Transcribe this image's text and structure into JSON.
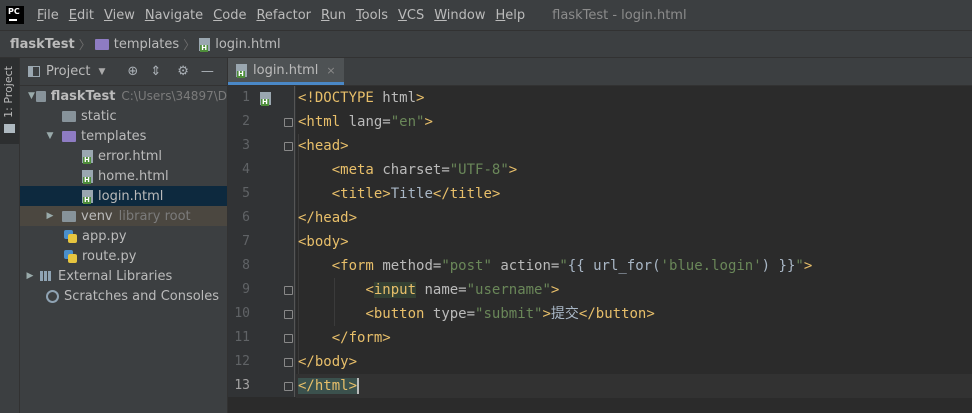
{
  "menubar": {
    "logo": "PC",
    "items": [
      {
        "label": "File",
        "u": "F",
        "rest": "ile"
      },
      {
        "label": "Edit",
        "u": "E",
        "rest": "dit"
      },
      {
        "label": "View",
        "u": "V",
        "rest": "iew"
      },
      {
        "label": "Navigate",
        "u": "N",
        "rest": "avigate"
      },
      {
        "label": "Code",
        "u": "C",
        "rest": "ode"
      },
      {
        "label": "Refactor",
        "u": "R",
        "rest": "efactor"
      },
      {
        "label": "Run",
        "u": "R",
        "rest": "un"
      },
      {
        "label": "Tools",
        "u": "T",
        "rest": "ools"
      },
      {
        "label": "VCS",
        "u": "V",
        "rest": "CS"
      },
      {
        "label": "Window",
        "u": "W",
        "rest": "indow"
      },
      {
        "label": "Help",
        "u": "H",
        "rest": "elp"
      }
    ],
    "window_title": "flaskTest - login.html"
  },
  "breadcrumb": [
    "flaskTest",
    "templates",
    "login.html"
  ],
  "left_stripe": {
    "label": "1: Project"
  },
  "project": {
    "title": "Project",
    "tree": [
      {
        "label": "flaskTest",
        "extra": "C:\\Users\\34897\\D",
        "icon": "folder-grey",
        "depth": 0,
        "arrow": "▼"
      },
      {
        "label": "static",
        "icon": "folder-grey",
        "depth": 1,
        "arrow": ""
      },
      {
        "label": "templates",
        "icon": "folder-purple",
        "depth": 1,
        "arrow": "▼"
      },
      {
        "label": "error.html",
        "icon": "html",
        "depth": 2,
        "arrow": ""
      },
      {
        "label": "home.html",
        "icon": "html",
        "depth": 2,
        "arrow": ""
      },
      {
        "label": "login.html",
        "icon": "html",
        "depth": 2,
        "arrow": "",
        "selected": true
      },
      {
        "label": "venv",
        "extra": "library root",
        "icon": "folder-grey",
        "depth": 1,
        "arrow": "▶",
        "excluded": true
      },
      {
        "label": "app.py",
        "icon": "py",
        "depth": 1,
        "arrow": ""
      },
      {
        "label": "route.py",
        "icon": "py",
        "depth": 1,
        "arrow": ""
      },
      {
        "label": "External Libraries",
        "icon": "lib",
        "depth": 0,
        "arrow": "▶"
      },
      {
        "label": "Scratches and Consoles",
        "icon": "scratch",
        "depth": 0,
        "arrow": ""
      }
    ]
  },
  "editor": {
    "tab": "login.html",
    "tab_close": "×",
    "line_numbers": [
      "1",
      "2",
      "3",
      "4",
      "5",
      "6",
      "7",
      "8",
      "9",
      "10",
      "11",
      "12",
      "13"
    ],
    "current_line": 13
  },
  "colors": {
    "tag": "#e8bf6a",
    "attr": "#bababa",
    "string": "#6a8759",
    "text": "#a9b7c6",
    "selection": "#0d293e",
    "tab_underline": "#4a88c7"
  }
}
